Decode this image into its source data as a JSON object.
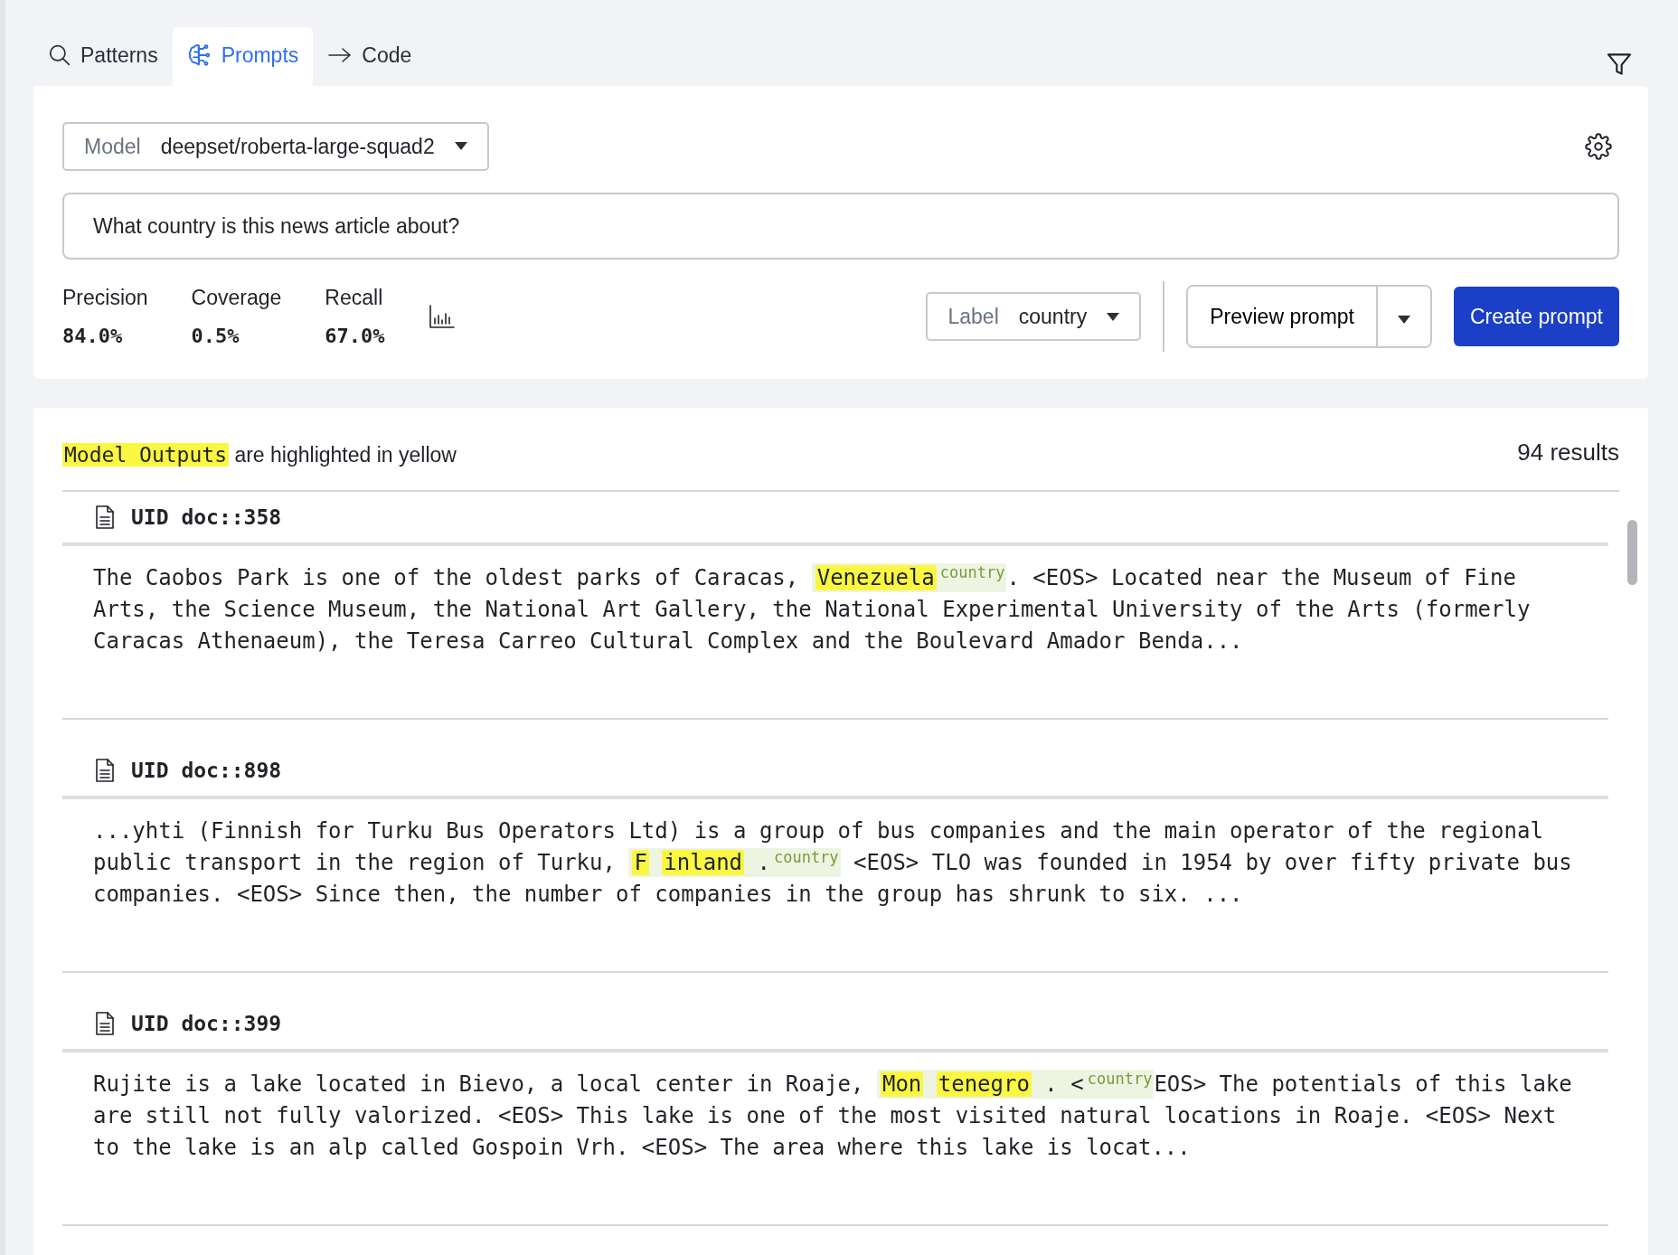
{
  "tabs": [
    {
      "label": "Patterns",
      "selected": false
    },
    {
      "label": "Prompts",
      "selected": true
    },
    {
      "label": "Code",
      "selected": false
    }
  ],
  "model_select": {
    "label": "Model",
    "value": "deepset/roberta-large-squad2"
  },
  "prompt": {
    "value": "What country is this news article about?"
  },
  "metrics": [
    {
      "name": "Precision",
      "value": "84.0%"
    },
    {
      "name": "Coverage",
      "value": "0.5%"
    },
    {
      "name": "Recall",
      "value": "67.0%"
    }
  ],
  "label_select": {
    "label": "Label",
    "value": "country"
  },
  "preview_button": "Preview prompt",
  "create_button": "Create prompt",
  "legend": {
    "highlight": "Model Outputs",
    "text": "are highlighted in yellow"
  },
  "results_count": "94 results",
  "documents": [
    {
      "uid": "UID doc::358",
      "segments": [
        {
          "kind": "text",
          "text": "The Caobos Park is one of the oldest parks of Caracas, "
        },
        {
          "kind": "span",
          "highlights": [
            "Venezuela"
          ],
          "label": "country"
        },
        {
          "kind": "text",
          "text": ". <EOS> Located near the Museum of Fine Arts, the Science Museum, the National Art Gallery, the National Experimental University of the Arts (formerly Caracas Athenaeum), the Teresa Carreo Cultural Complex and the Boulevard Amador Benda..."
        }
      ]
    },
    {
      "uid": "UID doc::898",
      "segments": [
        {
          "kind": "text",
          "text": "...yhti (Finnish for Turku Bus Operators Ltd) is a group of bus companies and the main operator of the regional public transport in the region of Turku, "
        },
        {
          "kind": "span",
          "highlights": [
            "F",
            "inland"
          ],
          "trail": " .",
          "label": "country"
        },
        {
          "kind": "text",
          "text": " <EOS> TLO was founded in 1954 by over fifty private bus companies. <EOS> Since then, the number of companies in the group has shrunk to six. ..."
        }
      ]
    },
    {
      "uid": "UID doc::399",
      "segments": [
        {
          "kind": "text",
          "text": "Rujite is a lake located in Bievo, a local center in Roaje, "
        },
        {
          "kind": "span",
          "highlights": [
            "Mon",
            "tenegro"
          ],
          "trail": " . <",
          "label": "country"
        },
        {
          "kind": "text",
          "text": "EOS> The potentials of this lake are still not fully valorized. <EOS> This lake is one of the most visited natural locations in Roaje. <EOS> Next to the lake is an alp called Gospoin Vrh. <EOS> The area where this lake is locat..."
        }
      ]
    }
  ]
}
